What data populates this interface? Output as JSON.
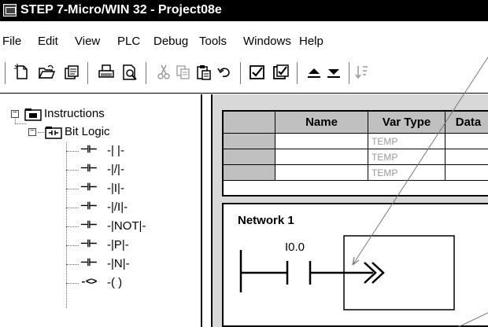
{
  "window": {
    "title": "STEP 7-Micro/WIN 32 - Project08e"
  },
  "menu": [
    "File",
    "Edit",
    "View",
    "PLC",
    "Debug",
    "Tools",
    "Windows",
    "Help"
  ],
  "toolbar_icons": [
    "new-icon",
    "open-icon",
    "copy-project-icon",
    "print-icon",
    "print-preview-icon",
    "cut-icon",
    "copy-icon",
    "paste-icon",
    "undo-icon",
    "compile-icon",
    "compile-all-icon",
    "upload-icon",
    "download-icon",
    "sort-icon"
  ],
  "tree": {
    "root": "Instructions",
    "folder": "Bit Logic",
    "items": [
      {
        "icon": "⊣⊢",
        "label": "-| |-"
      },
      {
        "icon": "⊣⊢",
        "label": "-|/|-"
      },
      {
        "icon": "⊣⊢",
        "label": "-|I|-"
      },
      {
        "icon": "⊣⊢",
        "label": "-|/I|-"
      },
      {
        "icon": "⊣⊢",
        "label": "-|NOT|-"
      },
      {
        "icon": "⊣⊢",
        "label": "-|P|-"
      },
      {
        "icon": "⊣⊢",
        "label": "-|N|-"
      },
      {
        "icon": "-<>",
        "label": "-( )"
      }
    ]
  },
  "var_table": {
    "columns": [
      "Name",
      "Var Type",
      "Data"
    ],
    "rows": [
      {
        "name": "",
        "var_type": "TEMP",
        "data": ""
      },
      {
        "name": "",
        "var_type": "TEMP",
        "data": ""
      },
      {
        "name": "",
        "var_type": "TEMP",
        "data": ""
      }
    ]
  },
  "editor": {
    "network_label": "Network 1",
    "contact_address": "I0.0"
  }
}
